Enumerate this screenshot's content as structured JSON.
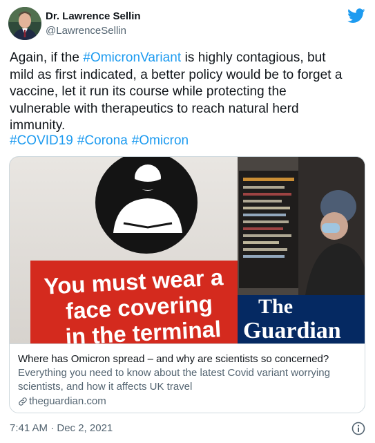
{
  "author": {
    "name": "Dr. Lawrence Sellin",
    "handle": "@LawrenceSellin"
  },
  "tweet": {
    "line1_pre": "Again, if the ",
    "line1_tag": "#OmicronVariant",
    "line1_post": " is highly contagious, but",
    "line2": "mild as first indicated, a better policy would be to forget a",
    "line3": "vaccine, let it run its course while protecting the",
    "line4": "vulnerable with therapeutics to reach natural herd",
    "line5": "immunity.",
    "hashtags": [
      "#COVID19",
      "#Corona",
      "#Omicron"
    ]
  },
  "card": {
    "sign_line1": "You must wear a",
    "sign_line2": "face covering",
    "sign_line3": "in the terminal",
    "logo_line1": "The",
    "logo_line2": "Guardian",
    "title": "Where has Omicron spread – and why are scientists so concerned?",
    "description_line1": "Everything you need to know about the latest Covid variant worrying",
    "description_line2": "scientists, and how it affects UK travel",
    "domain": "theguardian.com"
  },
  "meta": {
    "timestamp": "7:41 AM · Dec 2, 2021"
  },
  "colors": {
    "link": "#1d9bf0",
    "secondary": "#536471",
    "sign_red": "#d42a1e",
    "guardian_blue": "#052962"
  },
  "icons": [
    "twitter-bird-icon",
    "link-icon",
    "info-icon"
  ]
}
